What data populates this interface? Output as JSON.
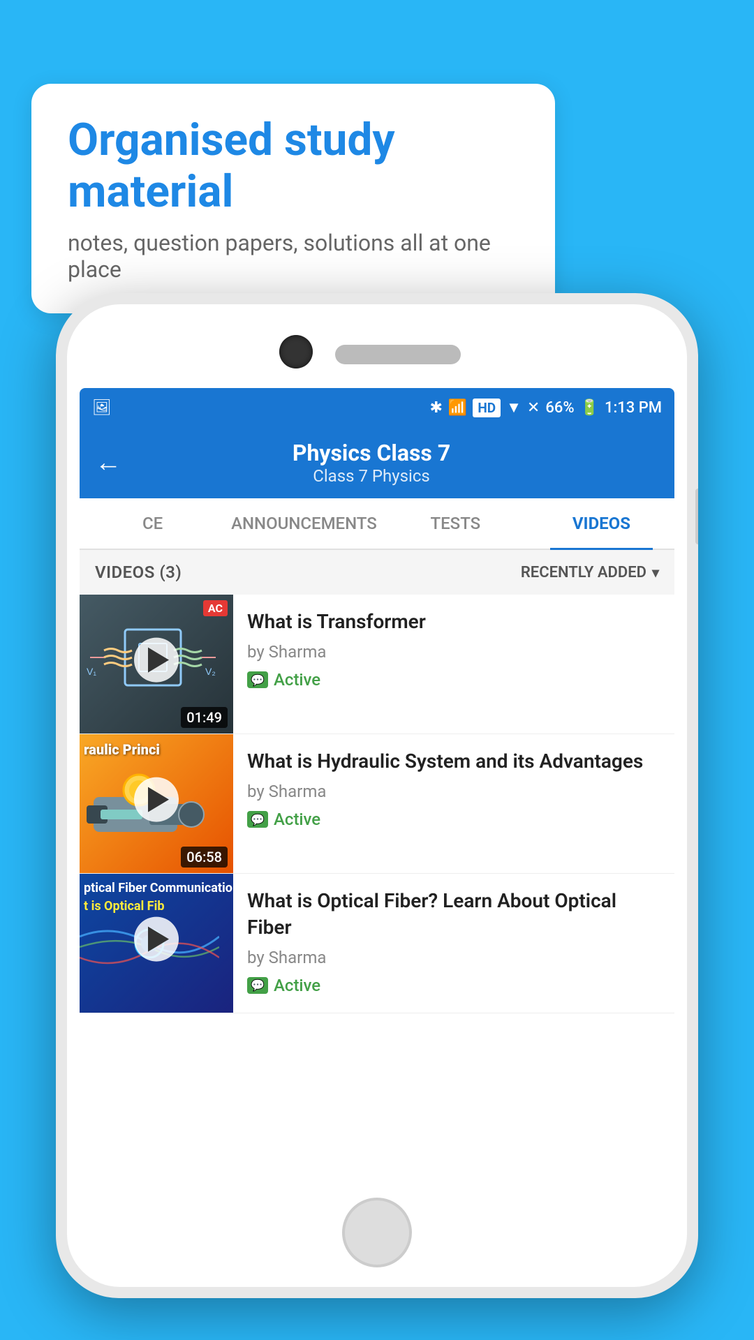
{
  "bubble": {
    "title": "Organised study material",
    "subtitle": "notes, question papers, solutions all at one place"
  },
  "status_bar": {
    "time": "1:13 PM",
    "battery": "66%",
    "signal": "HD"
  },
  "app_bar": {
    "back_label": "←",
    "title": "Physics Class 7",
    "breadcrumb": "Class 7   Physics"
  },
  "tabs": [
    {
      "label": "CE",
      "active": false
    },
    {
      "label": "ANNOUNCEMENTS",
      "active": false
    },
    {
      "label": "TESTS",
      "active": false
    },
    {
      "label": "VIDEOS",
      "active": true
    }
  ],
  "videos_header": {
    "count_label": "VIDEOS (3)",
    "sort_label": "RECENTLY ADDED"
  },
  "videos": [
    {
      "title": "What is  Transformer",
      "author": "by Sharma",
      "status": "Active",
      "duration": "01:49",
      "thumb_type": "transformer"
    },
    {
      "title": "What is Hydraulic System and its Advantages",
      "author": "by Sharma",
      "status": "Active",
      "duration": "06:58",
      "thumb_type": "hydraulic"
    },
    {
      "title": "What is Optical Fiber? Learn About Optical Fiber",
      "author": "by Sharma",
      "status": "Active",
      "duration": "",
      "thumb_type": "optical"
    }
  ]
}
